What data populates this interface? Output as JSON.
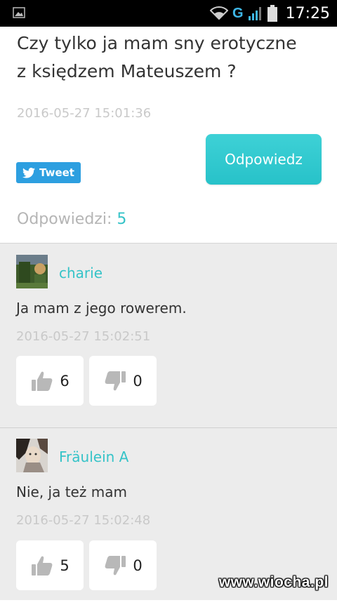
{
  "status_bar": {
    "network": "G",
    "time": "17:25"
  },
  "question": {
    "title_line1": "Czy tylko ja mam sny erotyczne",
    "title_line2": "z księdzem Mateuszem ?",
    "date": "2016-05-27 15:01:36"
  },
  "tweet_button": {
    "label": "Tweet"
  },
  "reply_button": {
    "label": "Odpowiedz"
  },
  "answers_header": {
    "label": "Odpowiedzi:",
    "count": "5"
  },
  "answers": [
    {
      "username": "charie",
      "text": "Ja mam z jego rowerem.",
      "date": "2016-05-27 15:02:51",
      "likes": "6",
      "dislikes": "0"
    },
    {
      "username": "Fräulein A",
      "text": "Nie, ja też mam",
      "date": "2016-05-27 15:02:48",
      "likes": "5",
      "dislikes": "0"
    }
  ],
  "watermark": "www.wiocha.pl",
  "colors": {
    "accent": "#35c3c8",
    "tweet": "#2d9fe0",
    "answers_bg": "#ececec"
  },
  "icons": {
    "status_left": "image-notification-icon",
    "wifi": "wifi-icon",
    "signal": "signal-icon",
    "battery": "battery-icon",
    "twitter": "twitter-bird-icon",
    "like": "thumbs-up-icon",
    "dislike": "thumbs-down-icon"
  }
}
